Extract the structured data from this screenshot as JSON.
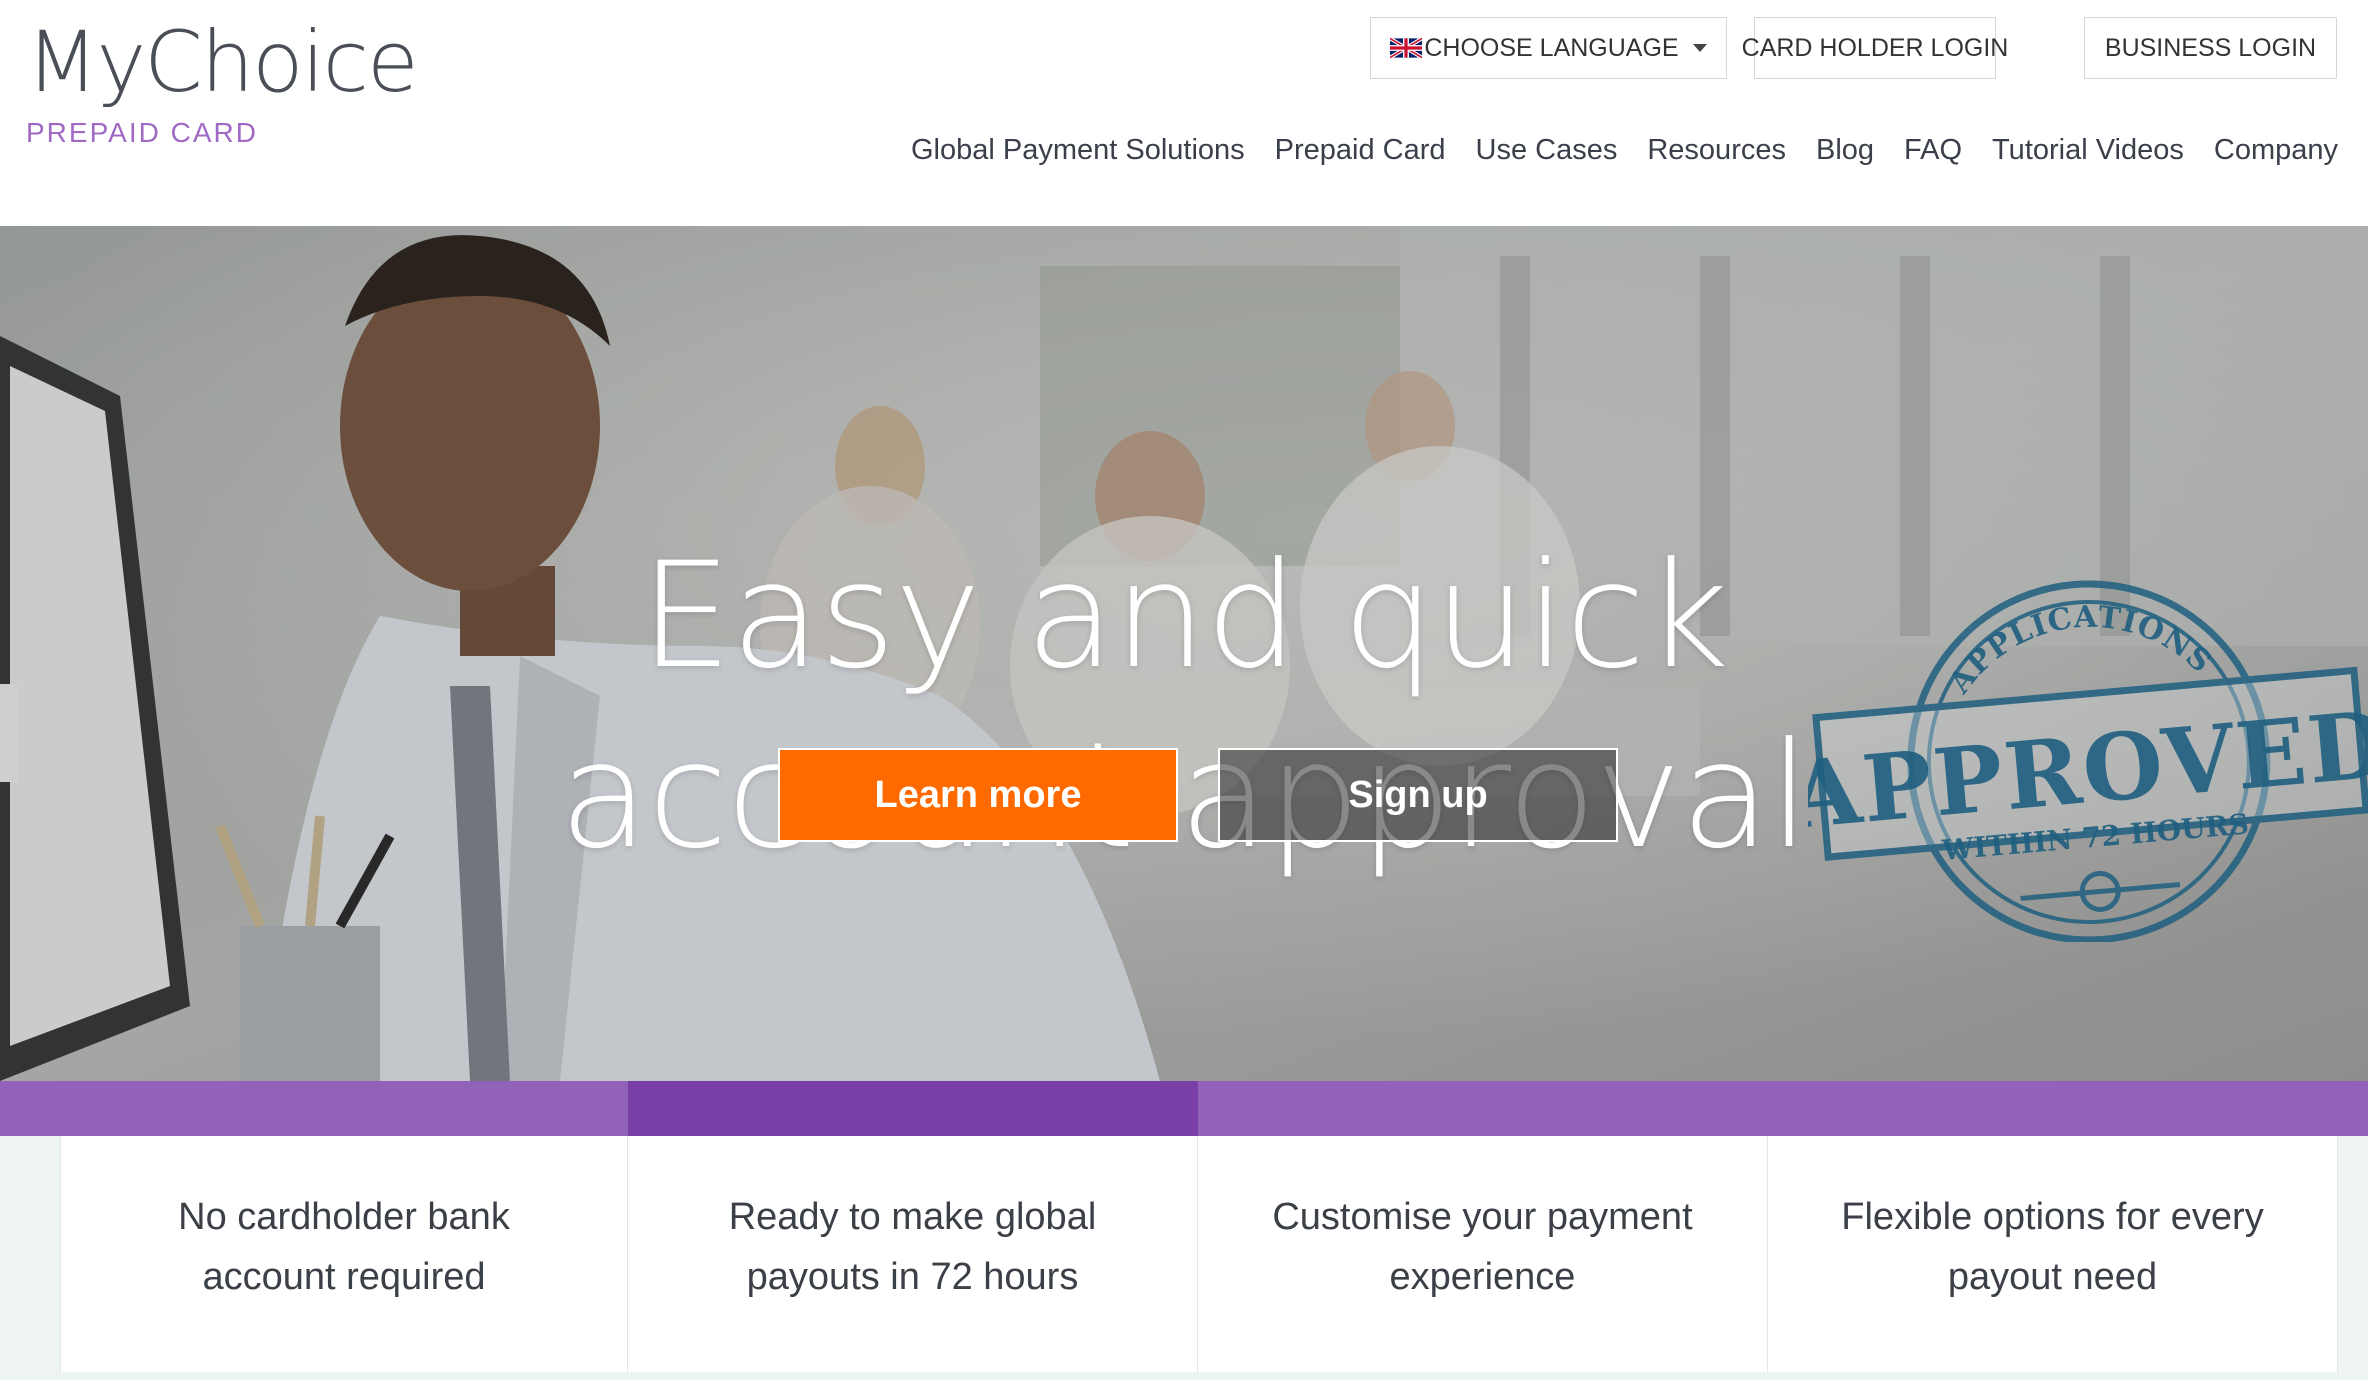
{
  "logo": {
    "main": "MyChoice",
    "sub": "PREPAID CARD"
  },
  "top_buttons": {
    "language": "CHOOSE LANGUAGE",
    "cardholder_login": "CARD HOLDER LOGIN",
    "business_login": "BUSINESS LOGIN"
  },
  "nav": [
    "Global Payment Solutions",
    "Prepaid Card",
    "Use Cases",
    "Resources",
    "Blog",
    "FAQ",
    "Tutorial Videos",
    "Company"
  ],
  "hero": {
    "title_line1": "Easy and quick",
    "title_line2": "account approval",
    "learn_more": "Learn more",
    "sign_up": "Sign up"
  },
  "stamp": {
    "top": "APPLICATIONS",
    "main": "APPROVED",
    "bottom": "WITHIN 72 HOURS"
  },
  "features": [
    "No cardholder bank\naccount required",
    "Ready to make global\npayouts in 72 hours",
    "Customise your payment\nexperience",
    "Flexible options for every\npayout need"
  ],
  "colors": {
    "accent_orange": "#ff6a00",
    "purple_light": "#9261b8",
    "purple_dark": "#7a3fa6",
    "logo_sub": "#a06ac4",
    "stamp_blue": "#1f5f80"
  }
}
